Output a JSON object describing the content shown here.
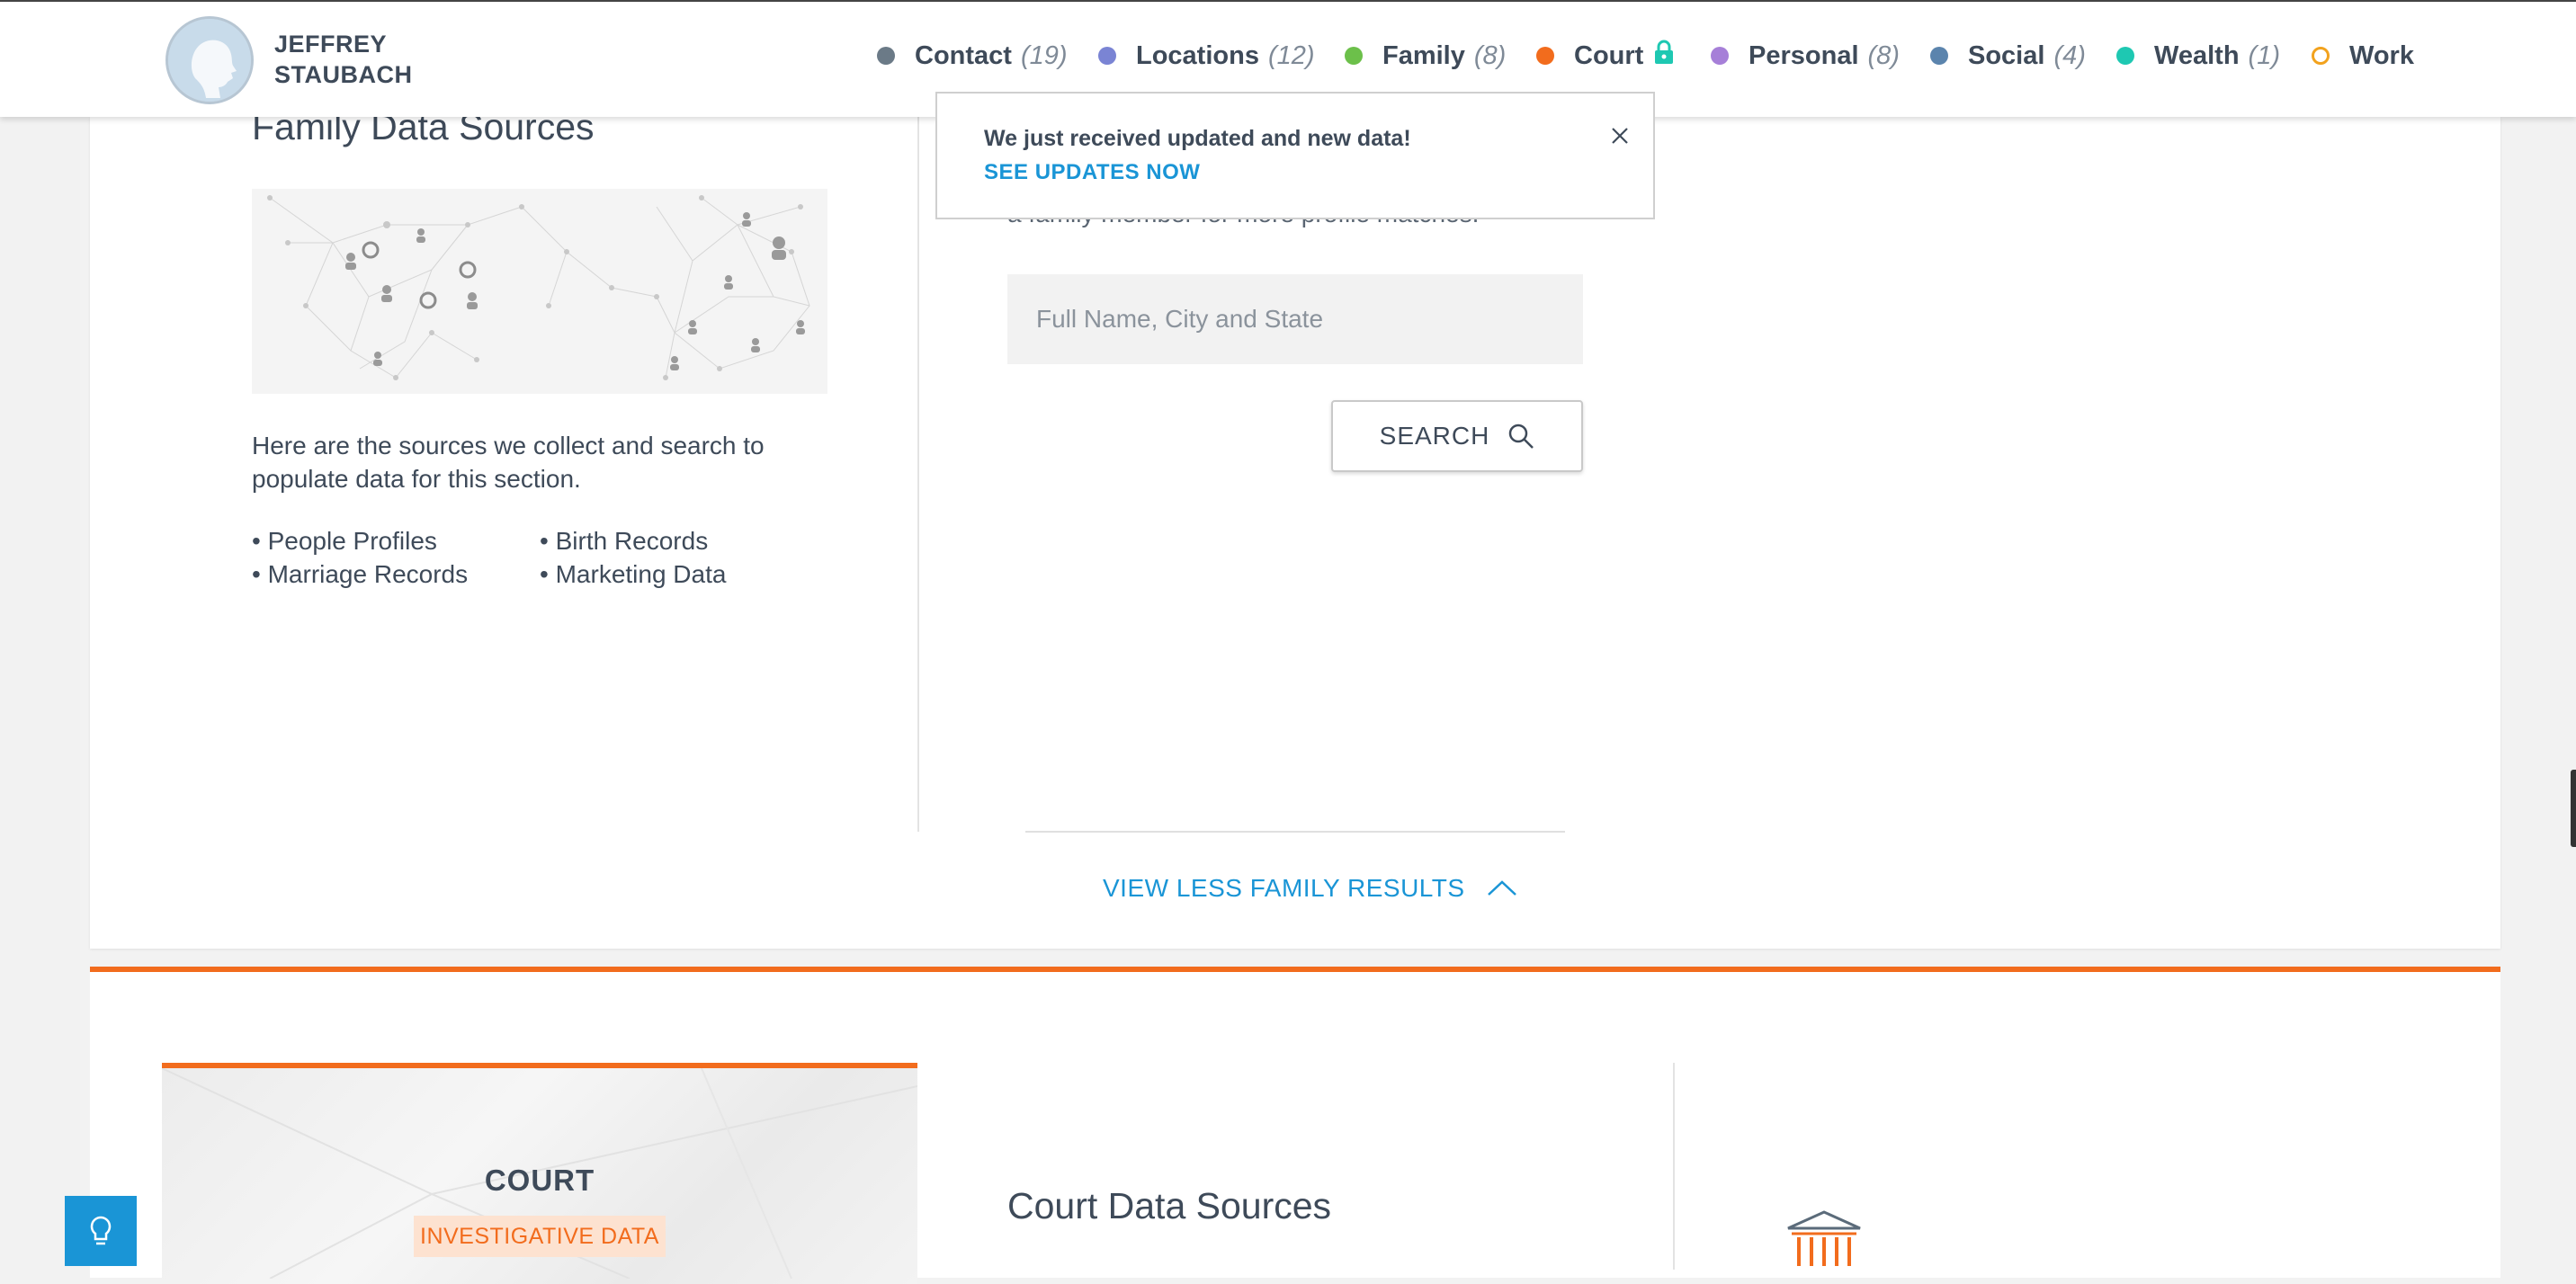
{
  "header": {
    "person_name_line1": "JEFFREY",
    "person_name_line2": "STAUBACH",
    "nav": [
      {
        "label": "Contact",
        "count": "(19)",
        "color": "#6b7a87",
        "icon": "dot"
      },
      {
        "label": "Locations",
        "count": "(12)",
        "color": "#7a84d4",
        "icon": "dot"
      },
      {
        "label": "Family",
        "count": "(8)",
        "color": "#6cc04a",
        "icon": "dot"
      },
      {
        "label": "Court",
        "count": "",
        "color": "#f26c1d",
        "icon": "lock-icon"
      },
      {
        "label": "Personal",
        "count": "(8)",
        "color": "#a67fd8",
        "icon": "dot"
      },
      {
        "label": "Social",
        "count": "(4)",
        "color": "#5b84ad",
        "icon": "dot"
      },
      {
        "label": "Wealth",
        "count": "(1)",
        "color": "#1ec8b2",
        "icon": "dot"
      },
      {
        "label": "Work",
        "count": "",
        "color": "#f2a21d",
        "icon": "ring"
      }
    ]
  },
  "notification": {
    "message": "We just received updated and new data!",
    "link": "SEE UPDATES NOW"
  },
  "family": {
    "title": "Family Data Sources",
    "description": "Here are the sources we collect and search to populate data for this section.",
    "sources": [
      "People Profiles",
      "Birth Records",
      "Marriage Records",
      "Marketing Data"
    ],
    "partial_text": "a family member for more profile matches.",
    "search_placeholder": "Full Name, City and State",
    "search_button": "SEARCH",
    "view_less": "VIEW LESS FAMILY RESULTS"
  },
  "court": {
    "card_title": "COURT",
    "badge": "INVESTIGATIVE DATA",
    "sources_title": "Court Data Sources"
  },
  "colors": {
    "accent_blue": "#1a95d6",
    "court_orange": "#f26c1d"
  }
}
